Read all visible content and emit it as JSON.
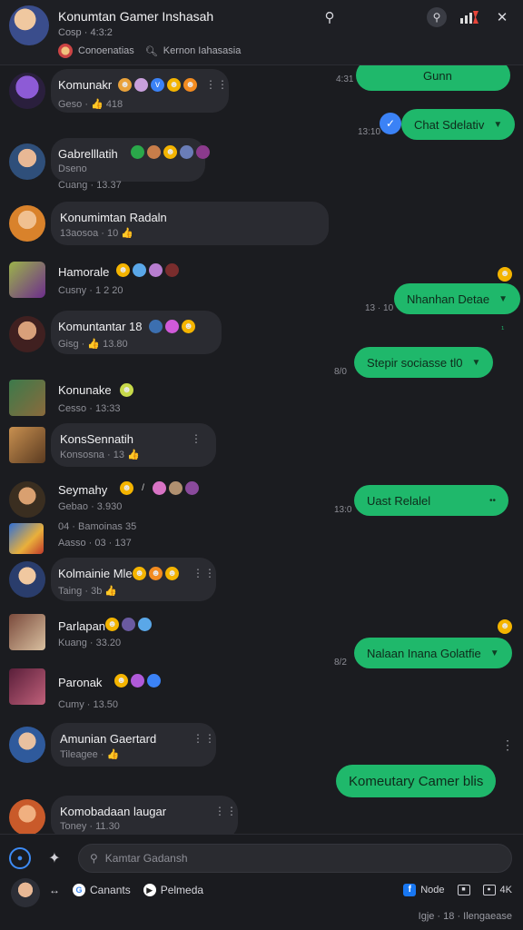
{
  "header": {
    "title": "Konumtan Gamer Inshasah",
    "subtitle": "Cosp · 4:3:2",
    "sub_row_left": "Conoenatias",
    "sub_row_right": "Kernon Iahasasia"
  },
  "messages_in": [
    {
      "name": "Komunakr",
      "meta": "Geso · 👍 418"
    },
    {
      "name": "Gabrelllatih",
      "meta": "Dseno",
      "meta2": "Cuang · 13.37"
    },
    {
      "name": "Konumimtan Radaln",
      "meta": "13aosoa · 10 👍"
    },
    {
      "name": "Hamorale",
      "meta": "Cusny · 1 2 20"
    },
    {
      "name": "Komuntantar 18",
      "meta": "Gisg · 👍 13.80"
    },
    {
      "name": "Konunake",
      "meta": "Cesso · 13:33"
    },
    {
      "name": "KonsSennatih",
      "meta": "Konsosna · 13 👍"
    },
    {
      "name": "Seymahy",
      "meta": "Gebao · 3.930"
    },
    {
      "name": "",
      "meta": "04 · Bamoinas 35",
      "meta2": "Aasso · 03 · 137"
    },
    {
      "name": "Kolmainie Mle",
      "meta": "Taing · 3b 👍"
    },
    {
      "name": "Parlapan",
      "meta": "Kuang · 33.20"
    },
    {
      "name": "Paronak",
      "meta": "Cumy · 13.50"
    },
    {
      "name": "Amunian Gaertard",
      "meta": "Tileagee · 👍"
    },
    {
      "name": "Komobadaan laugar",
      "meta": "Toney · 11.30"
    }
  ],
  "messages_out": [
    {
      "text": "Gunn",
      "time": "4:31"
    },
    {
      "text": "Chat Sdelativ",
      "time": "13:10"
    },
    {
      "text": "Nhanhan Detae",
      "time": "13 · 10"
    },
    {
      "text": "Stepir sociasse tl0",
      "time": "8/0"
    },
    {
      "text": "Uast Relalel",
      "time": "13:0"
    },
    {
      "text": "Nalaan Inana Golatfie",
      "time": "8/2"
    },
    {
      "text": "Komeutary Camer blis",
      "time": ""
    }
  ],
  "footer": {
    "input_placeholder": "Kamtar Gadansh",
    "chip1": "Canants",
    "chip2": "Pelmeda",
    "right1": "Node",
    "right2": "4K",
    "status": "Igje · 18 · Ilengaease"
  }
}
